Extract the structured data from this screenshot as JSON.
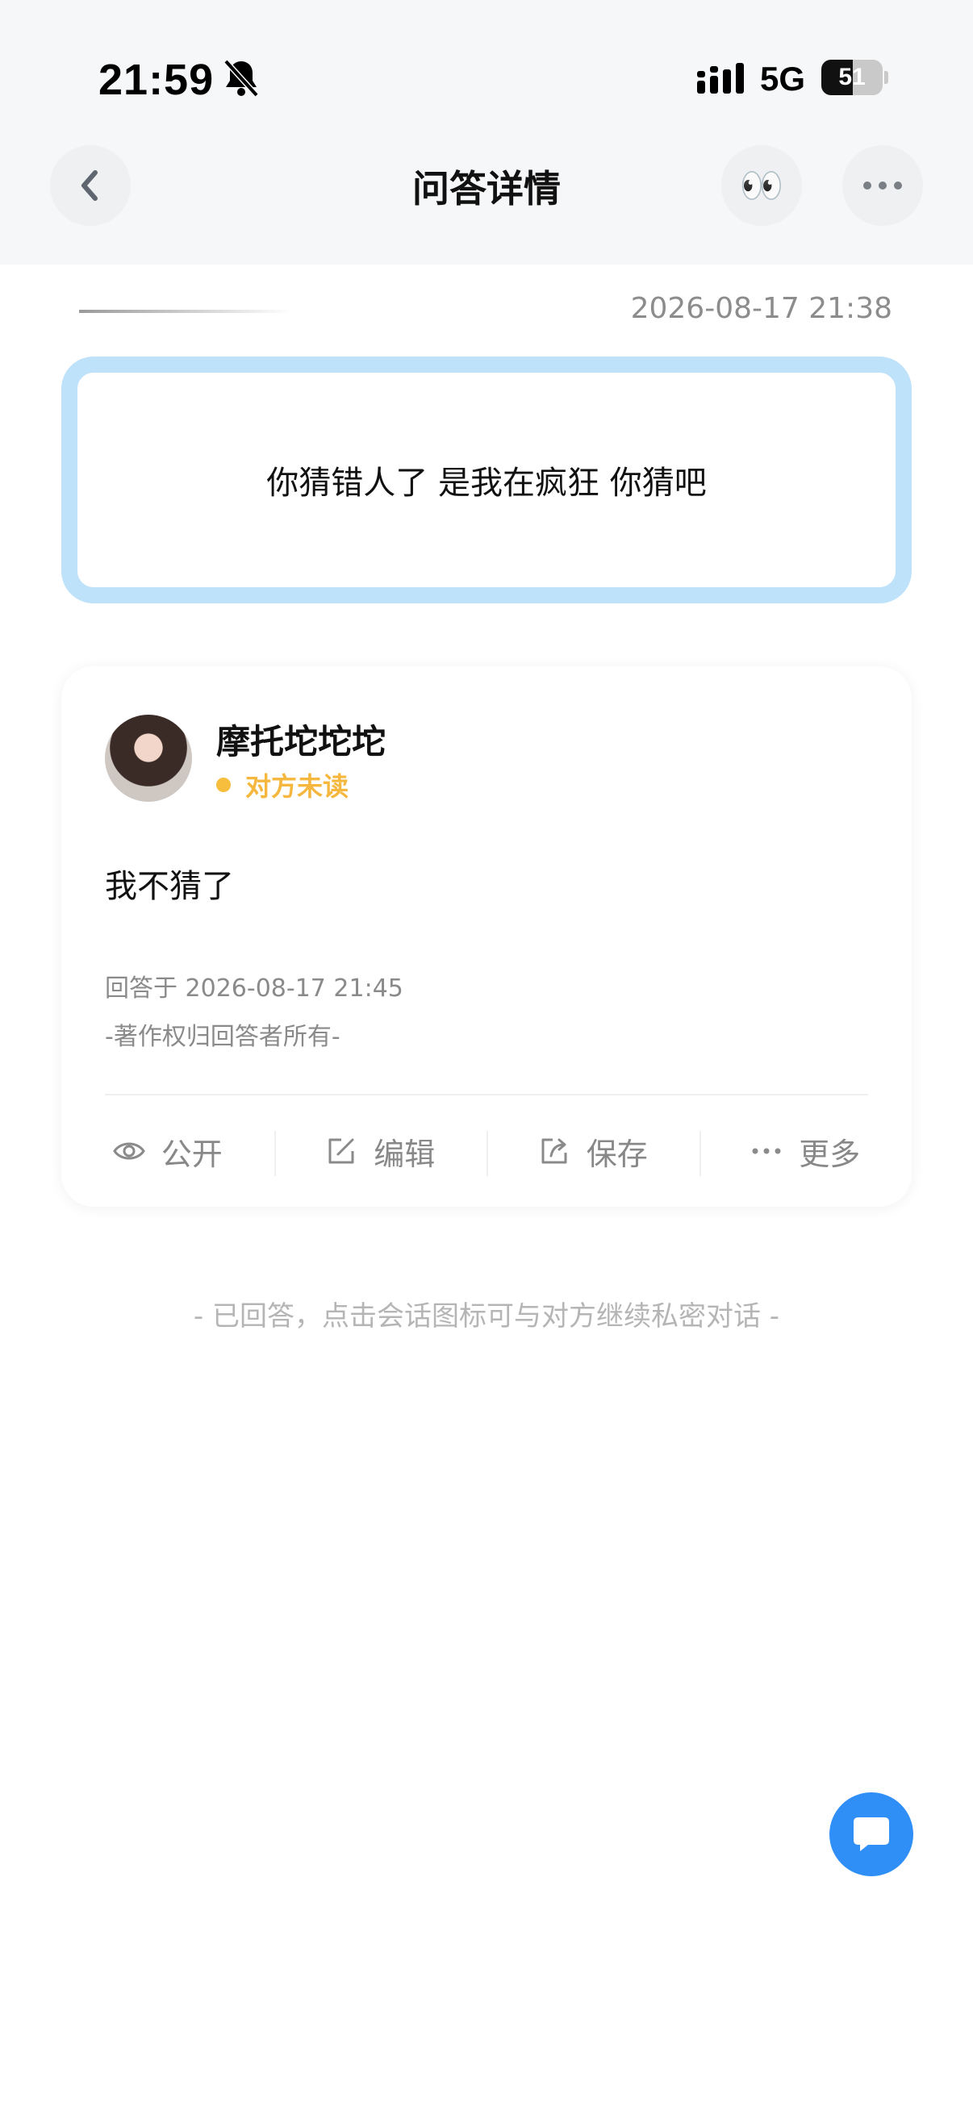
{
  "status_bar": {
    "time": "21:59",
    "network": "5G",
    "battery_level": 51,
    "battery_text": "51",
    "icons": [
      "bell-slash-icon",
      "signal-icon",
      "battery-icon"
    ]
  },
  "nav": {
    "title": "问答详情",
    "back_icon": "chevron-left-icon",
    "eyes_emoji": "👀",
    "more_icon": "ellipsis-icon"
  },
  "question": {
    "time": "2026-08-17 21:38",
    "text": "你猜错人了  是我在疯狂 你猜吧"
  },
  "answer": {
    "name": "摩托坨坨坨",
    "read_status": "对方未读",
    "text": "我不猜了",
    "answered_at": "回答于 2026-08-17 21:45",
    "copyright": "-著作权归回答者所有-",
    "actions": [
      {
        "label": "公开",
        "icon": "eye-icon"
      },
      {
        "label": "编辑",
        "icon": "edit-icon"
      },
      {
        "label": "保存",
        "icon": "share-icon"
      },
      {
        "label": "更多",
        "icon": "ellipsis-icon"
      }
    ]
  },
  "footnote": "- 已回答，点击会话图标可与对方继续私密对话 -",
  "colors": {
    "accent_blue": "#2f8ff7",
    "question_border": "#bfe2fb",
    "unread_yellow": "#f5b73e"
  }
}
